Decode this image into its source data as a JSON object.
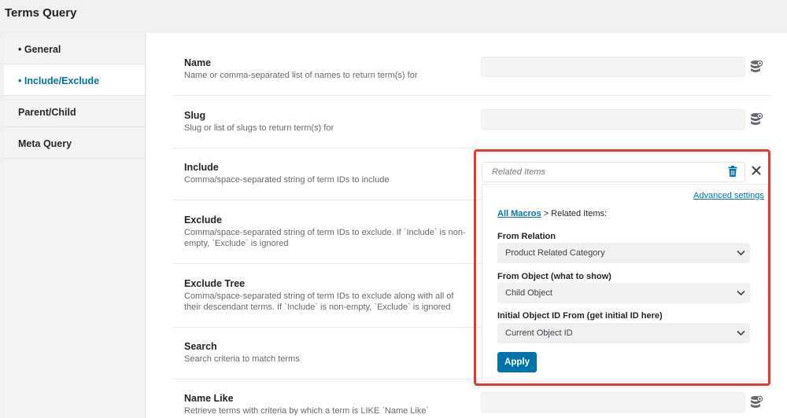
{
  "window": {
    "title": "Terms Query"
  },
  "sidebar": {
    "items": [
      {
        "label": "• General",
        "active": false
      },
      {
        "label": "• Include/Exclude",
        "active": true
      },
      {
        "label": "Parent/Child",
        "active": false
      },
      {
        "label": "Meta Query",
        "active": false
      }
    ]
  },
  "fields": [
    {
      "label": "Name",
      "description": "Name or comma-separated list of names to return term(s) for",
      "value": ""
    },
    {
      "label": "Slug",
      "description": "Slug or list of slugs to return term(s) for",
      "value": ""
    },
    {
      "label": "Include",
      "description": "Comma/space-separated string of term IDs to include"
    },
    {
      "label": "Exclude",
      "description": "Comma/space-separated string of term IDs to exclude. If `Include` is non-empty, `Exclude` is ignored"
    },
    {
      "label": "Exclude Tree",
      "description": "Comma/space-separated string of term IDs to exclude along with all of their descendant terms. If `Include` is non-empty, `Exclude` is ignored"
    },
    {
      "label": "Search",
      "description": "Search criteria to match terms"
    },
    {
      "label": "Name Like",
      "description": "Retrieve terms with criteria by which a term is LIKE `Name Like`",
      "value": ""
    }
  ],
  "macro_popup": {
    "header_placeholder": "Related Items",
    "advanced_settings": "Advanced settings",
    "crumb_link": "All Macros",
    "crumb_rest": " > Related Items:",
    "from_relation_label": "From Relation",
    "from_relation_value": "Product Related Category",
    "from_object_label": "From Object (what to show)",
    "from_object_value": "Child Object",
    "initial_id_label": "Initial Object ID From (get initial ID here)",
    "initial_id_value": "Current Object ID",
    "apply_label": "Apply"
  },
  "colors": {
    "accent": "#0073aa",
    "highlight": "#e53935"
  },
  "icons": [
    "database-icon",
    "trash-icon",
    "close-icon",
    "chevron-down-icon"
  ]
}
